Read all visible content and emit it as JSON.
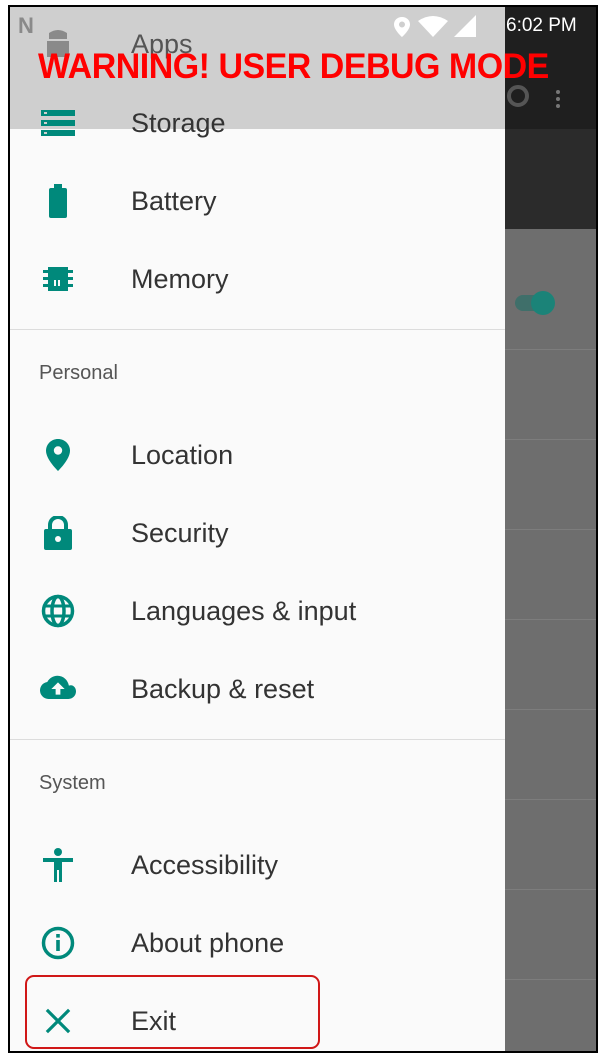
{
  "status_bar": {
    "time": "6:02 PM",
    "icons": [
      "notification-n-icon",
      "location-icon",
      "wifi-icon",
      "signal-icon"
    ]
  },
  "warning_banner": "WARNING! USER DEBUG MODE",
  "drawer": {
    "top_items": [
      {
        "label": "Apps",
        "icon": "android-icon"
      },
      {
        "label": "Storage",
        "icon": "storage-icon"
      },
      {
        "label": "Battery",
        "icon": "battery-icon"
      },
      {
        "label": "Memory",
        "icon": "memory-icon"
      }
    ],
    "sections": [
      {
        "title": "Personal",
        "items": [
          {
            "label": "Location",
            "icon": "location-pin-icon"
          },
          {
            "label": "Security",
            "icon": "lock-icon"
          },
          {
            "label": "Languages & input",
            "icon": "globe-icon"
          },
          {
            "label": "Backup & reset",
            "icon": "cloud-upload-icon"
          }
        ]
      },
      {
        "title": "System",
        "items": [
          {
            "label": "Accessibility",
            "icon": "accessibility-icon"
          },
          {
            "label": "About phone",
            "icon": "info-icon"
          },
          {
            "label": "Exit",
            "icon": "close-icon"
          }
        ]
      }
    ]
  },
  "colors": {
    "accent": "#00897b",
    "warning": "#ff0000",
    "highlight_box": "#d01717"
  }
}
